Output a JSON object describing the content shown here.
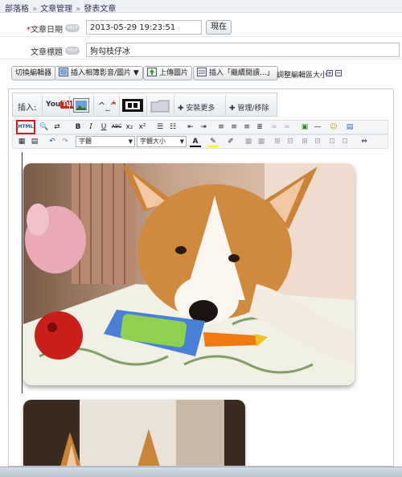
{
  "breadcrumb": {
    "items": [
      "部落格",
      "文章管理",
      "發表文章"
    ]
  },
  "form": {
    "date_label": "文章日期",
    "required_mark": "*",
    "help_label": "HELP",
    "date_value": "2013-05-29 19:23:51",
    "now_button": "現在",
    "title_label": "文章標題",
    "title_value": "狗勾枝仔冰"
  },
  "toolbar": {
    "switch_editor": "切換編輯器",
    "insert_album": "插入相簿影音/圖片",
    "upload_image": "上傳圖片",
    "insert_readmore": "插入「繼續閱讀...」",
    "adjust_label": "調整編輯區大小"
  },
  "plugins": {
    "insert_label": "插入:",
    "youtube": "You",
    "youtube_b": "Tube",
    "install_more": "安裝更多",
    "manage": "管理/移除"
  },
  "format": {
    "html": "HTML",
    "font": "字體",
    "font_size": "字體大小"
  },
  "colors": {
    "accent_red": "#e3101a",
    "bar_blue": "#b9c5d2"
  }
}
